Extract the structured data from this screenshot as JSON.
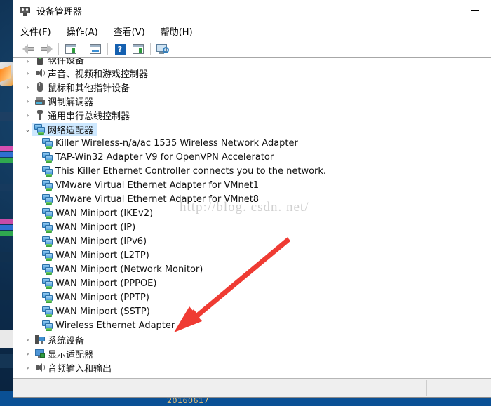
{
  "window": {
    "title": "设备管理器",
    "icon": "device-manager-icon",
    "minimize_label": "—"
  },
  "menubar": {
    "items": [
      {
        "label": "文件(F)",
        "name": "menu-file"
      },
      {
        "label": "操作(A)",
        "name": "menu-action"
      },
      {
        "label": "查看(V)",
        "name": "menu-view"
      },
      {
        "label": "帮助(H)",
        "name": "menu-help"
      }
    ]
  },
  "toolbar": {
    "buttons": [
      {
        "name": "back-arrow-icon",
        "tooltip": "后退"
      },
      {
        "name": "forward-arrow-icon",
        "tooltip": "前进"
      },
      {
        "name": "show-hide-console-tree-icon",
        "tooltip": "显示/隐藏控制台树"
      },
      {
        "name": "properties-icon",
        "tooltip": "属性"
      },
      {
        "name": "help-icon",
        "tooltip": "帮助"
      },
      {
        "name": "update-driver-icon",
        "tooltip": "更新驱动程序"
      },
      {
        "name": "scan-hardware-changes-icon",
        "tooltip": "扫描检测硬件改动"
      }
    ]
  },
  "tree": {
    "collapsed_glyph": "›",
    "expanded_glyph": "⌄",
    "nodes": [
      {
        "label": "软件设备",
        "icon": "software-device-icon",
        "expanded": false,
        "level": 1
      },
      {
        "label": "声音、视频和游戏控制器",
        "icon": "sound-video-game-controller-icon",
        "expanded": false,
        "level": 1
      },
      {
        "label": "鼠标和其他指针设备",
        "icon": "mouse-pointing-device-icon",
        "expanded": false,
        "level": 1
      },
      {
        "label": "调制解调器",
        "icon": "modem-icon",
        "expanded": false,
        "level": 1
      },
      {
        "label": "通用串行总线控制器",
        "icon": "usb-controller-icon",
        "expanded": false,
        "level": 1
      },
      {
        "label": "网络适配器",
        "icon": "network-adapter-icon",
        "expanded": true,
        "level": 1,
        "selected": true
      },
      {
        "label": "Killer Wireless-n/a/ac 1535 Wireless Network Adapter",
        "icon": "network-adapter-icon",
        "level": 2
      },
      {
        "label": "TAP-Win32 Adapter V9 for OpenVPN Accelerator",
        "icon": "network-adapter-icon",
        "level": 2
      },
      {
        "label": "This Killer Ethernet Controller connects you to the network.",
        "icon": "network-adapter-icon",
        "level": 2
      },
      {
        "label": "VMware Virtual Ethernet Adapter for VMnet1",
        "icon": "network-adapter-icon",
        "level": 2
      },
      {
        "label": "VMware Virtual Ethernet Adapter for VMnet8",
        "icon": "network-adapter-icon",
        "level": 2
      },
      {
        "label": "WAN Miniport (IKEv2)",
        "icon": "network-adapter-icon",
        "level": 2
      },
      {
        "label": "WAN Miniport (IP)",
        "icon": "network-adapter-icon",
        "level": 2
      },
      {
        "label": "WAN Miniport (IPv6)",
        "icon": "network-adapter-icon",
        "level": 2
      },
      {
        "label": "WAN Miniport (L2TP)",
        "icon": "network-adapter-icon",
        "level": 2
      },
      {
        "label": "WAN Miniport (Network Monitor)",
        "icon": "network-adapter-icon",
        "level": 2
      },
      {
        "label": "WAN Miniport (PPPOE)",
        "icon": "network-adapter-icon",
        "level": 2
      },
      {
        "label": "WAN Miniport (PPTP)",
        "icon": "network-adapter-icon",
        "level": 2
      },
      {
        "label": "WAN Miniport (SSTP)",
        "icon": "network-adapter-icon",
        "level": 2
      },
      {
        "label": "Wireless Ethernet Adapter",
        "icon": "network-adapter-icon",
        "level": 2
      },
      {
        "label": "系统设备",
        "icon": "system-device-icon",
        "expanded": false,
        "level": 1
      },
      {
        "label": "显示适配器",
        "icon": "display-adapter-icon",
        "expanded": false,
        "level": 1
      },
      {
        "label": "音频输入和输出",
        "icon": "audio-input-output-icon",
        "expanded": false,
        "level": 1
      }
    ]
  },
  "annotation": {
    "arrow_color": "#ef3b33",
    "target": "Wireless Ethernet Adapter"
  },
  "watermark": {
    "text": "http://blog. csdn. net/"
  },
  "taskbar": {
    "text": "20160617"
  },
  "colors": {
    "selection": "#cde8ff",
    "window_bg": "#ffffff",
    "statusbar_bg": "#efefef",
    "accent_red": "#ef3b33",
    "taskbar_blue": "#0a5095"
  }
}
